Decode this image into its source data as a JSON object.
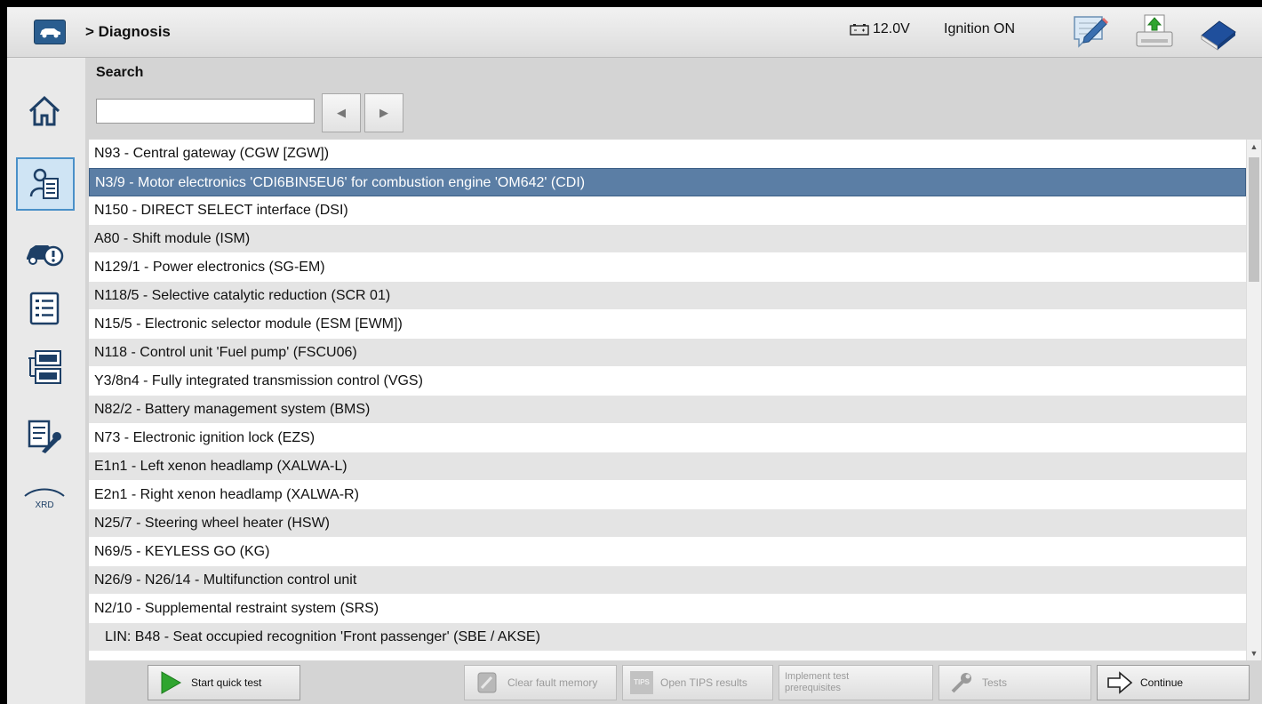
{
  "header": {
    "breadcrumb": "> Diagnosis",
    "voltage": "12.0V",
    "ignition": "Ignition ON"
  },
  "search": {
    "label": "Search",
    "value": ""
  },
  "list": {
    "selected_index": 1,
    "items": [
      "N93 - Central gateway (CGW [ZGW])",
      "N3/9 - Motor electronics 'CDI6BIN5EU6' for combustion engine 'OM642' (CDI)",
      "N150 - DIRECT SELECT interface (DSI)",
      "A80 - Shift module (ISM)",
      "N129/1 - Power electronics (SG-EM)",
      "N118/5 - Selective catalytic reduction (SCR 01)",
      "N15/5 - Electronic selector module (ESM [EWM])",
      "N118 - Control unit 'Fuel pump' (FSCU06)",
      "Y3/8n4 - Fully integrated transmission control (VGS)",
      "N82/2 - Battery management system (BMS)",
      "N73 - Electronic ignition lock (EZS)",
      "E1n1 - Left xenon headlamp (XALWA-L)",
      "E2n1 - Right xenon headlamp (XALWA-R)",
      "N25/7 - Steering wheel heater (HSW)",
      "N69/5 - KEYLESS GO (KG)",
      "N26/9 - N26/14 - Multifunction control unit",
      "N2/10 - Supplemental restraint system (SRS)",
      "LIN: B48 - Seat occupied recognition 'Front passenger' (SBE / AKSE)"
    ]
  },
  "sidebar": {
    "xrd_label": "XRD"
  },
  "buttons": {
    "start_quick_test": "Start quick test",
    "clear_fault_memory": "Clear fault memory",
    "tips_badge": "TIPS",
    "open_tips_results": "Open TIPS results",
    "implement_test_line1": "Implement test",
    "implement_test_line2": "prerequisites",
    "tests": "Tests",
    "continue": "Continue"
  },
  "colors": {
    "selection": "#5b7ea5",
    "accent": "#2a5d8f",
    "play_green": "#2fa52f"
  }
}
